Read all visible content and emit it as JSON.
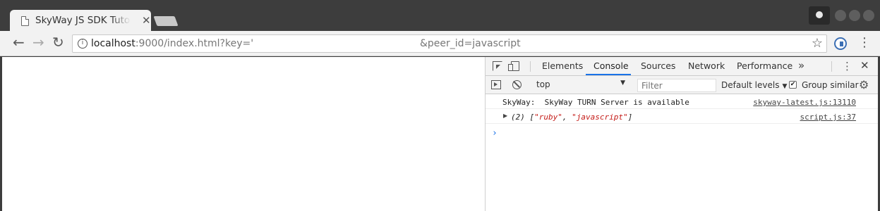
{
  "browser": {
    "tab_title": "SkyWay JS SDK Tutorial",
    "tab_close": "✕",
    "url_host": "localhost",
    "url_rest": ":9000/index.html?key='",
    "url_tail": "&peer_id=javascript",
    "back": "←",
    "forward": "→",
    "reload": "↻",
    "star": "☆",
    "menu": "⋮"
  },
  "devtools": {
    "tabs": [
      "Elements",
      "Console",
      "Sources",
      "Network",
      "Performance"
    ],
    "active_tab": "Console",
    "more": "»",
    "kebab": "⋮",
    "close": "✕",
    "context": "top",
    "filter_placeholder": "Filter",
    "levels": "Default levels",
    "group_similar": "Group similar",
    "group_similar_checked": true,
    "accent": "#1a73e8"
  },
  "console": {
    "messages": [
      {
        "text": "SkyWay:  SkyWay TURN Server is available",
        "source": "skyway-latest.js:13110"
      },
      {
        "prefix": "(2) [",
        "str1": "\"ruby\"",
        "sep": ", ",
        "str2": "\"javascript\"",
        "suffix": "]",
        "source": "script.js:37",
        "expandable": true
      }
    ],
    "prompt": "›"
  }
}
